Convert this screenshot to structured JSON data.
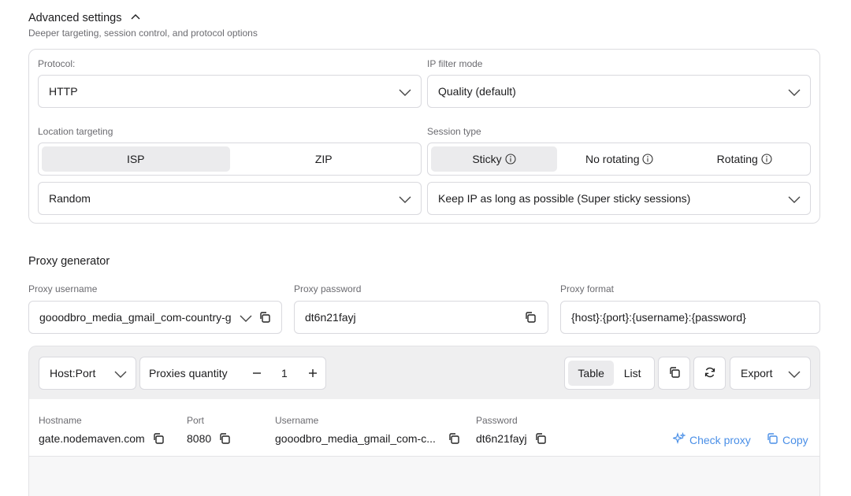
{
  "advanced": {
    "title": "Advanced settings",
    "subtitle": "Deeper targeting, session control, and protocol options"
  },
  "protocol": {
    "label": "Protocol:",
    "value": "HTTP"
  },
  "ip_filter": {
    "label": "IP filter mode",
    "value": "Quality (default)"
  },
  "location": {
    "label": "Location targeting",
    "options": [
      "ISP",
      "ZIP"
    ],
    "selected": "ISP",
    "value": "Random"
  },
  "session": {
    "label": "Session type",
    "options": [
      "Sticky",
      "No rotating",
      "Rotating"
    ],
    "selected": "Sticky",
    "value": "Keep IP as long as possible (Super sticky sessions)"
  },
  "generator": {
    "title": "Proxy generator",
    "username_label": "Proxy username",
    "username_value": "gooodbro_media_gmail_com-country-g",
    "password_label": "Proxy password",
    "password_value": "dt6n21fayj",
    "format_label": "Proxy format",
    "format_value": "{host}:{port}:{username}:{password}"
  },
  "toolbar": {
    "host_port": "Host:Port",
    "quantity_label": "Proxies quantity",
    "quantity": "1",
    "view_table": "Table",
    "view_list": "List",
    "export": "Export"
  },
  "table": {
    "headers": [
      "Hostname",
      "Port",
      "Username",
      "Password"
    ],
    "row": {
      "hostname": "gate.nodemaven.com",
      "port": "8080",
      "username": "gooodbro_media_gmail_com-c...",
      "password": "dt6n21fayj"
    },
    "check_proxy": "Check proxy",
    "copy": "Copy"
  },
  "colors": {
    "accent_link": "#4a8fe7",
    "active_seg": "#ebebed"
  }
}
